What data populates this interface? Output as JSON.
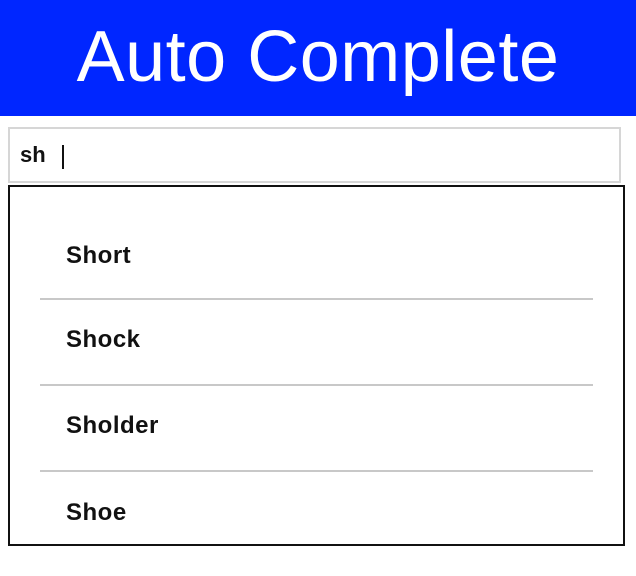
{
  "header": {
    "title": "Auto Complete",
    "background_color": "#0026ff",
    "text_color": "#ffffff"
  },
  "search": {
    "value": "sh",
    "placeholder": ""
  },
  "suggestions": {
    "items": [
      {
        "label": "Short"
      },
      {
        "label": "Shock"
      },
      {
        "label": "Sholder"
      },
      {
        "label": "Shoe"
      }
    ]
  }
}
